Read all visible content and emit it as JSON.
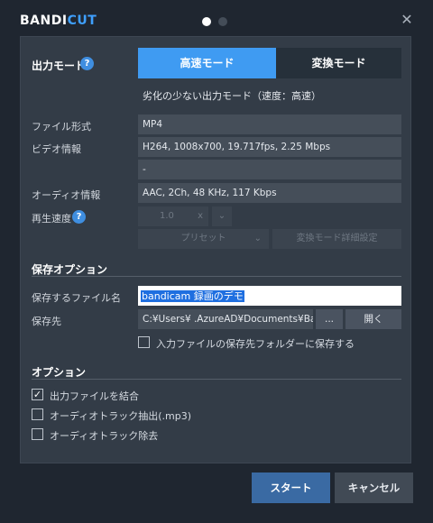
{
  "app": {
    "brand_part1": "BANDI",
    "brand_part2": "CUT",
    "close_glyph": "✕"
  },
  "output_mode": {
    "label": "出力モード",
    "help": "?",
    "fast_mode": "高速モード",
    "convert_mode": "変換モード",
    "description": "劣化の少ない出力モード（速度：高速）"
  },
  "info": {
    "format_label": "ファイル形式",
    "format_value": "MP4",
    "video_label": "ビデオ情報",
    "video_value": "H264, 1008x700, 19.717fps, 2.25 Mbps",
    "extra_value": "-",
    "audio_label": "オーディオ情報",
    "audio_value": "AAC, 2Ch, 48 KHz, 117 Kbps",
    "speed_label": "再生速度",
    "speed_help": "?",
    "speed_value": "1.0",
    "speed_unit": "x",
    "speed_arrow": "⌄",
    "preset": "プリセット",
    "preset_arrow": "⌄",
    "advanced": "変換モード詳細設定"
  },
  "save": {
    "title": "保存オプション",
    "filename_label": "保存するファイル名",
    "filename_value": "bandicam 録画のデモ",
    "dest_label": "保存先",
    "dest_value": "C:¥Users¥         .AzureAD¥Documents¥Ba",
    "browse": "...",
    "open": "開く",
    "same_folder": "入力ファイルの保存先フォルダーに保存する"
  },
  "options": {
    "title": "オプション",
    "merge": "出力ファイルを結合",
    "merge_checked": "✓",
    "extract_audio": "オーディオトラック抽出(.mp3)",
    "remove_audio": "オーディオトラック除去"
  },
  "footer": {
    "start": "スタート",
    "cancel": "キャンセル"
  },
  "colors": {
    "accent": "#3f9bf2",
    "panel": "#333c47",
    "background": "#1f2630"
  }
}
